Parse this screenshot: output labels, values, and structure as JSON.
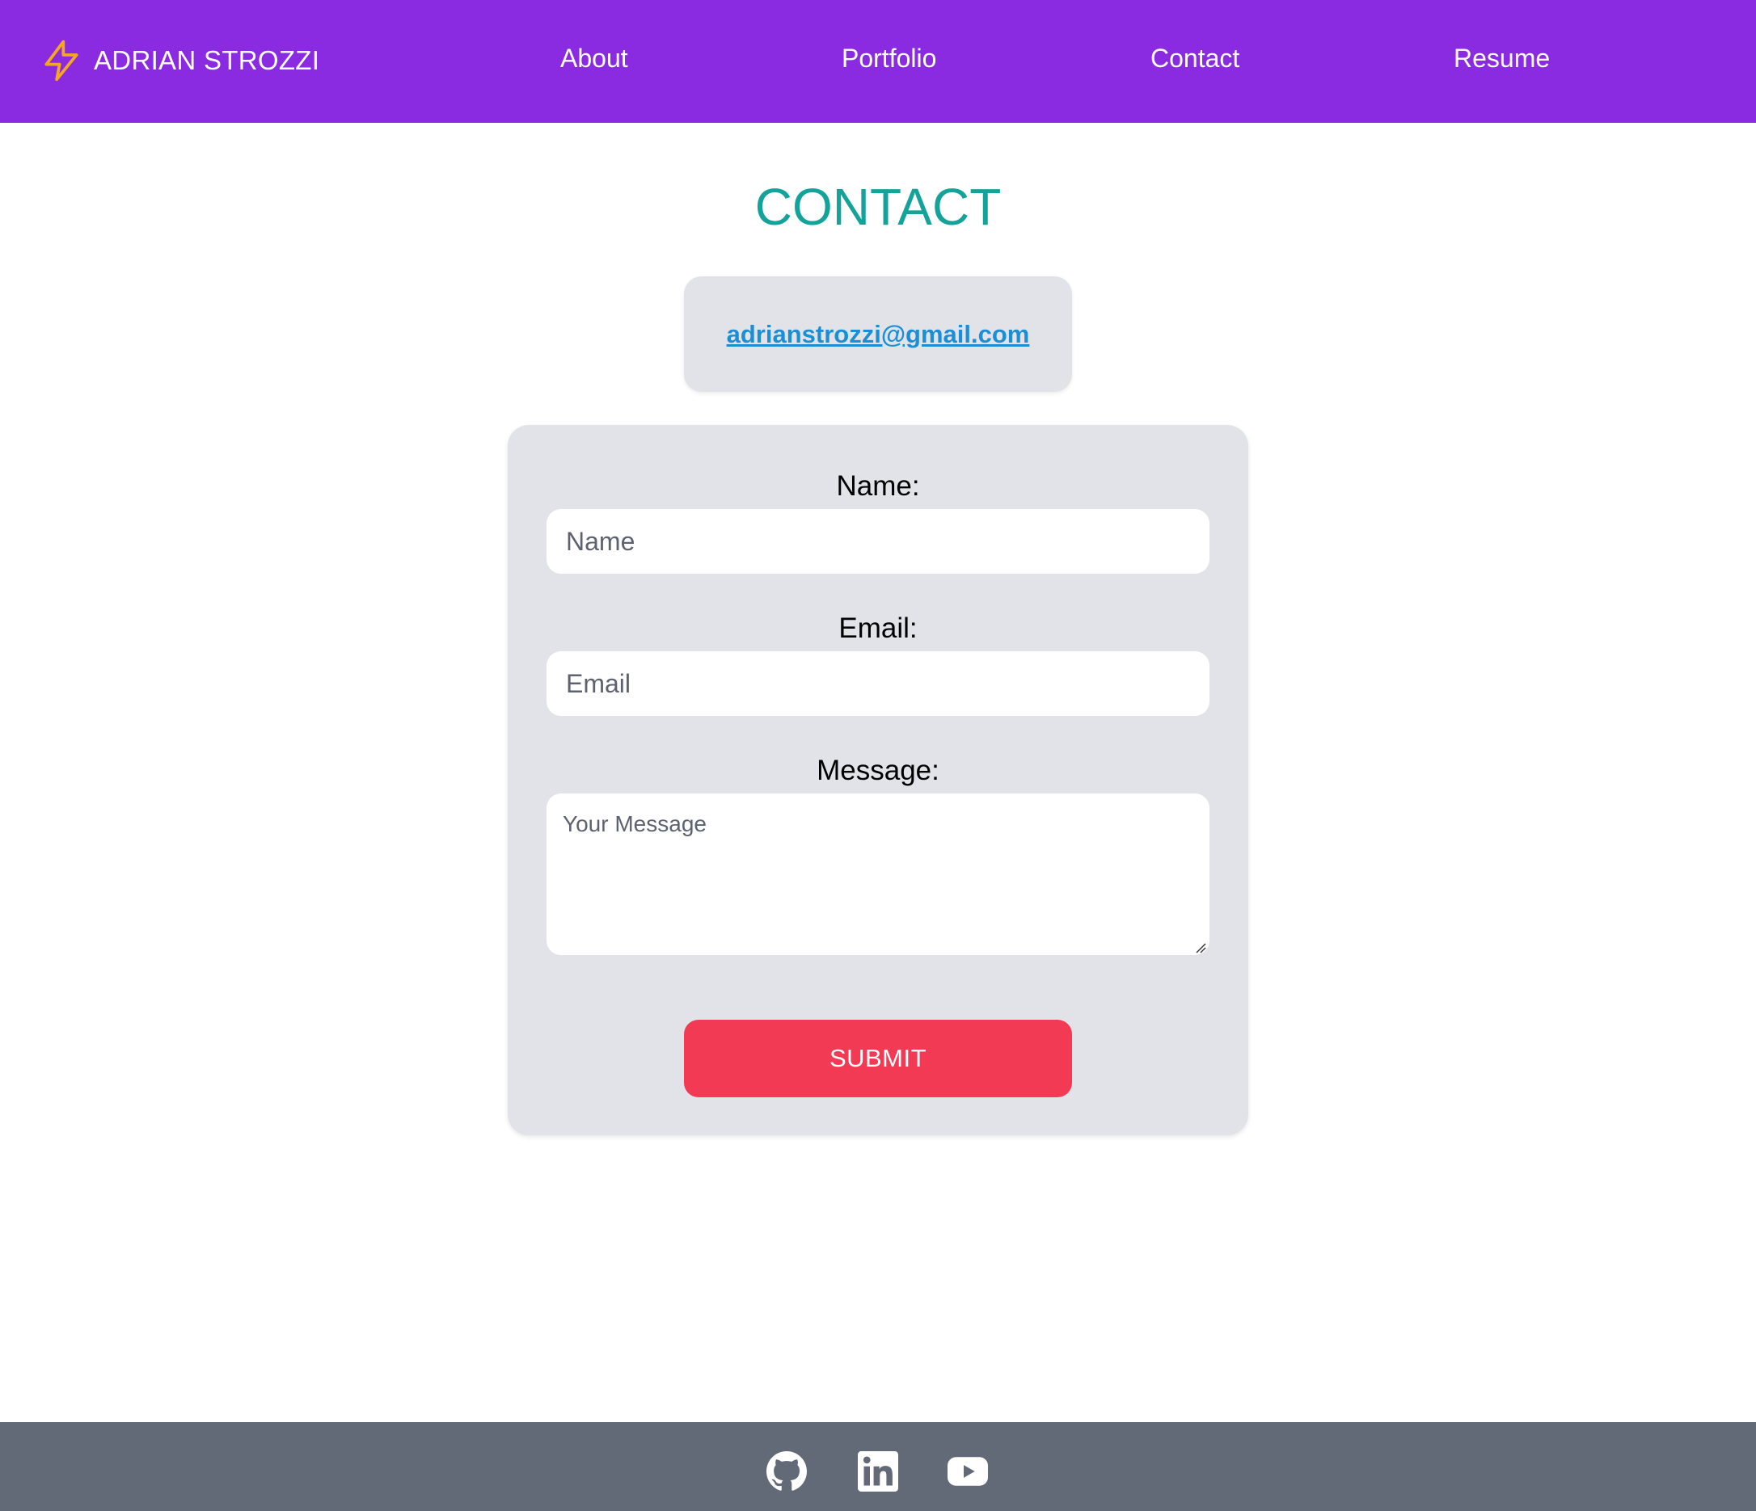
{
  "header": {
    "brand_name": "ADRIAN STROZZI",
    "brand_icon": "lightning-bolt-icon",
    "brand_icon_color": "#f5a623",
    "background_color": "#8a2be2",
    "nav": [
      {
        "label": "About"
      },
      {
        "label": "Portfolio"
      },
      {
        "label": "Contact"
      },
      {
        "label": "Resume"
      }
    ]
  },
  "main": {
    "title": "CONTACT",
    "title_color": "#14a39a",
    "email": "adrianstrozzi@gmail.com",
    "form": {
      "name_label": "Name:",
      "name_placeholder": "Name",
      "email_label": "Email:",
      "email_placeholder": "Email",
      "message_label": "Message:",
      "message_placeholder": "Your Message",
      "submit_label": "SUBMIT",
      "submit_color": "#f23a55"
    }
  },
  "footer": {
    "background_color": "#636a77",
    "social": [
      {
        "icon": "github-icon"
      },
      {
        "icon": "linkedin-icon"
      },
      {
        "icon": "youtube-icon"
      }
    ]
  }
}
